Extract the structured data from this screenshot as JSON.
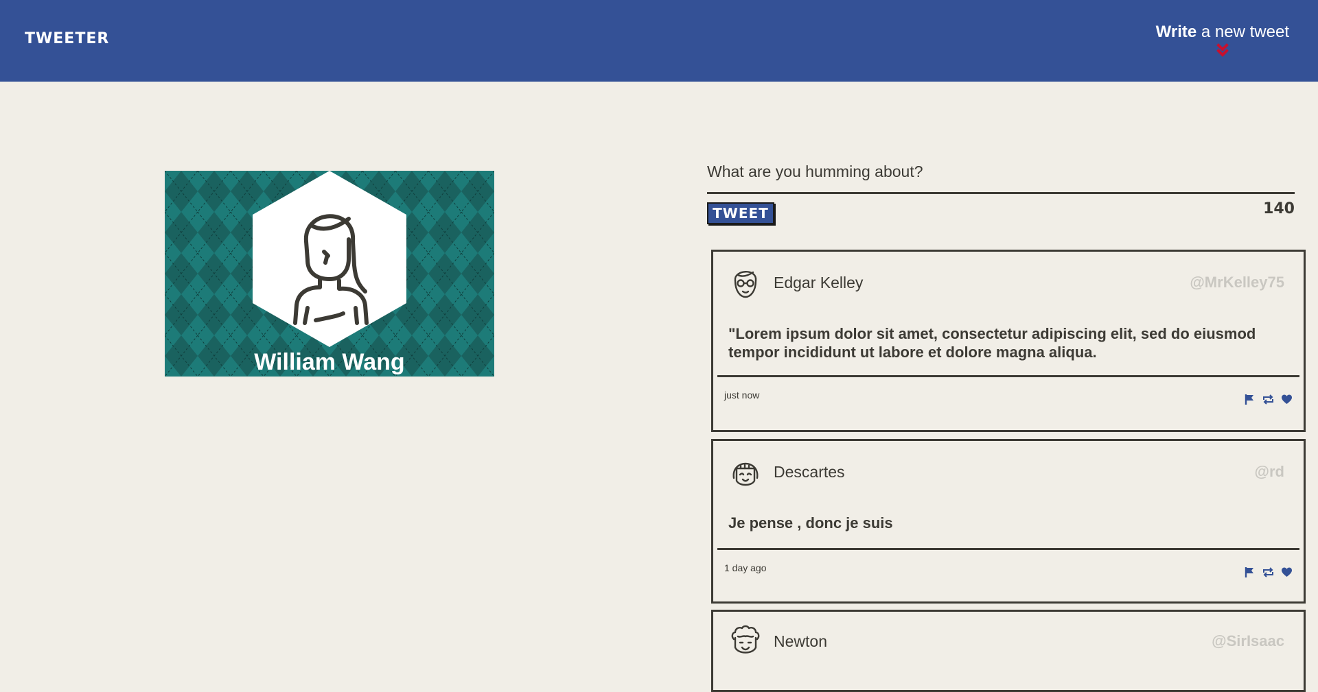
{
  "nav": {
    "brand": "TWEETER",
    "compose_toggle_bold": "Write",
    "compose_toggle_rest": " a new tweet",
    "chevron_color": "#c8102e",
    "background_color": "#345196"
  },
  "profile": {
    "name": "William Wang",
    "banner_color": "#1d7b78"
  },
  "compose": {
    "placeholder": "What are you humming about?",
    "button_label": "TWEET",
    "char_count": "140"
  },
  "tweets": [
    {
      "author": "Edgar Kelley",
      "handle": "@MrKelley75",
      "content": "\"Lorem ipsum dolor sit amet, consectetur adipiscing elit, sed do eiusmod tempor incididunt ut labore et dolore magna aliqua.",
      "time": "just now",
      "avatar_icon": "glasses-man-avatar-icon"
    },
    {
      "author": "Descartes",
      "handle": "@rd",
      "content": "Je pense , donc je suis",
      "time": "1 day ago",
      "avatar_icon": "bob-hair-avatar-icon"
    },
    {
      "author": "Newton",
      "handle": "@SirIsaac",
      "content": "",
      "time": "",
      "avatar_icon": "curly-hair-avatar-icon"
    }
  ],
  "actions": [
    "flag-icon",
    "retweet-icon",
    "heart-icon"
  ],
  "action_color": "#345196"
}
